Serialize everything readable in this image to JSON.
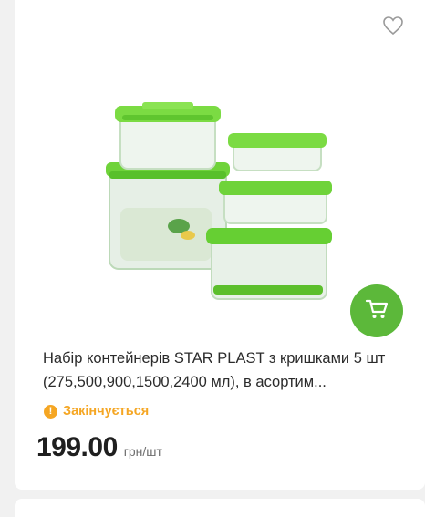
{
  "product": {
    "title": "Набір контейнерів STAR PLAST з кришками 5 шт (275,500,900,1500,2400 мл), в асортим...",
    "status": "Закінчується",
    "price": "199.00",
    "price_unit": "грн/шт"
  },
  "icons": {
    "favorite": "heart-outline-icon",
    "cart": "shopping-cart-icon",
    "status": "exclamation-circle-icon"
  },
  "colors": {
    "accent": "#5cb83a",
    "status": "#f5a623"
  }
}
